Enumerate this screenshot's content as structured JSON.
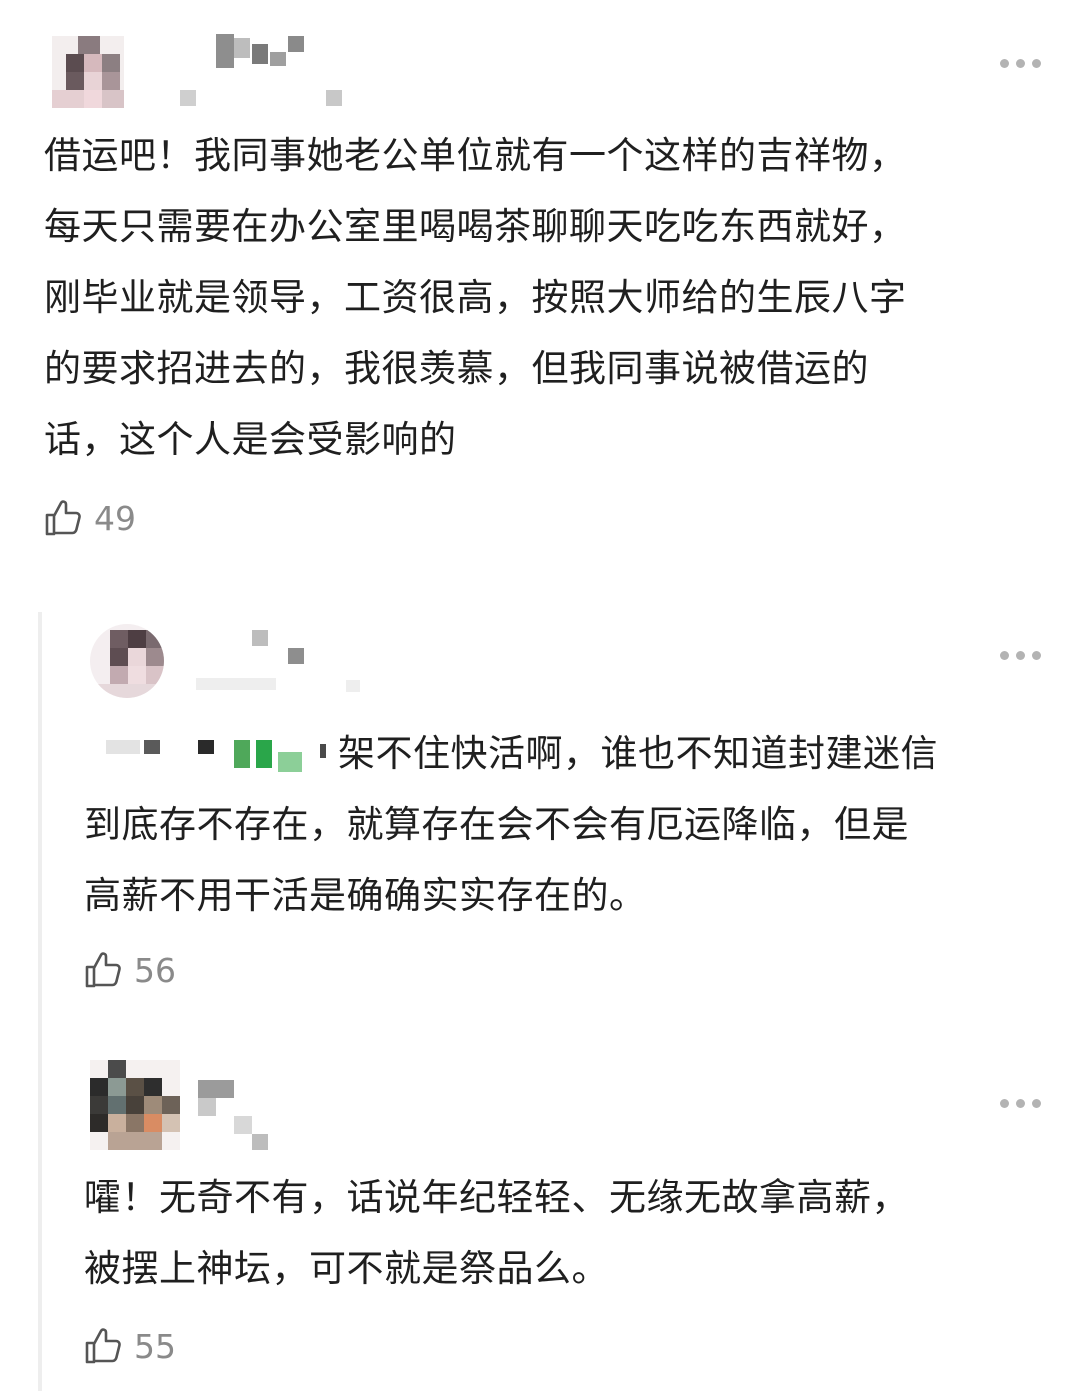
{
  "comments": [
    {
      "text": "借运吧！我同事她老公单位就有一个这样的吉祥物，\n每天只需要在办公室里喝喝茶聊聊天吃吃东西就好，\n刚毕业就是领导，工资很高，按照大师给的生辰八字\n的要求招进去的，我很羡慕，但我同事说被借运的\n话，这个人是会受影响的",
      "likes": "49"
    },
    {
      "text": "架不住快活啊，谁也不知道封建迷信",
      "text_cont": "到底存不存在，就算存在会不会有厄运降临，但是\n高薪不用干活是确确实实存在的。",
      "likes": "56"
    },
    {
      "text": "嚯！无奇不有，话说年纪轻轻、无缘无故拿高薪，\n被摆上神坛，可不就是祭品么。",
      "likes": "55"
    }
  ],
  "icons": {
    "more": "more-dots-icon",
    "like": "thumbs-up-icon"
  },
  "colors": {
    "text": "#1f1f1f",
    "secondary": "#8a8a8a",
    "icon": "#b3b3b3",
    "thread_line": "#eeeeee"
  }
}
